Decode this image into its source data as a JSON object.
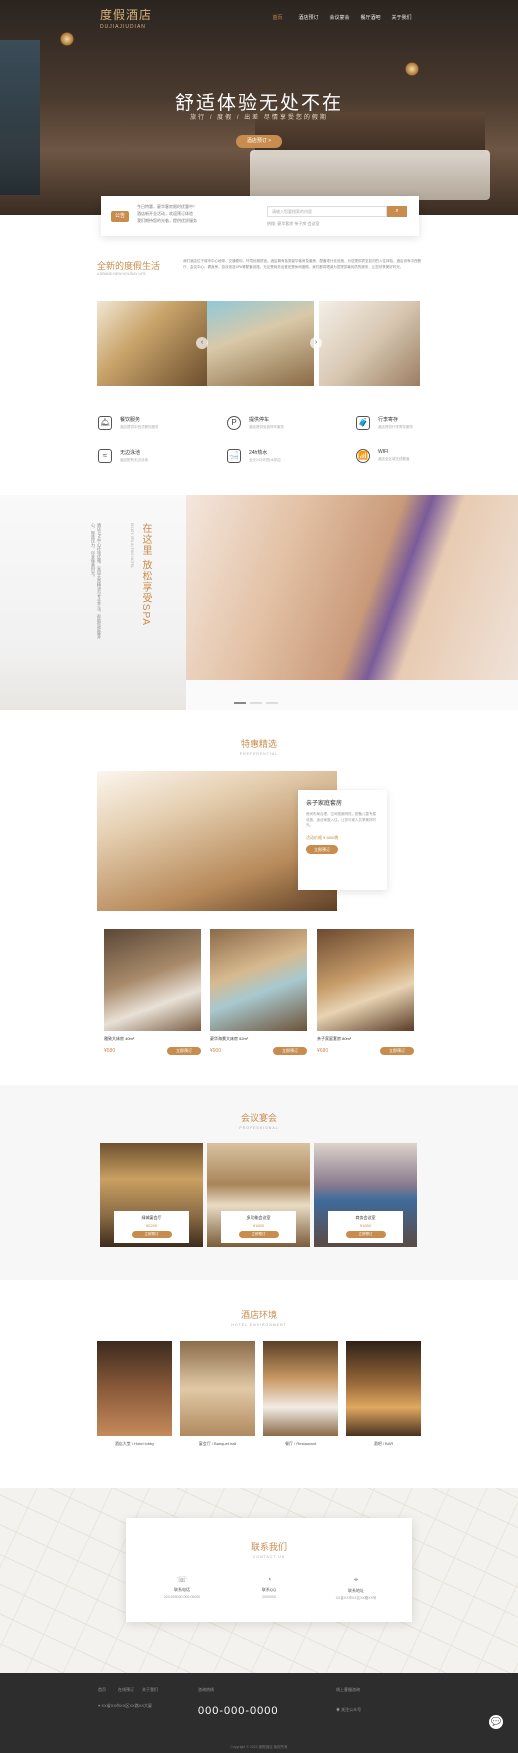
{
  "brand": {
    "name": "度假酒店",
    "en": "DUJIAJIUDIAN"
  },
  "nav": [
    "首页",
    "酒店预订",
    "会议宴会",
    "餐厅酒吧",
    "关于我们"
  ],
  "hero": {
    "title": "舒适体验无处不在",
    "subtitle": "旅行 / 度假 / 出差 尽情享受您的假期",
    "button": "酒店预订 >"
  },
  "notice": {
    "tag": "公告",
    "lines": [
      "今日特惠，豪华客房限时优惠中！",
      "酒店新开业活动，欢迎预订体验",
      "我们期待您的光临，提供优质服务"
    ],
    "search_placeholder": "请输入您要搜索的内容",
    "hot": "热搜: 豪华套房  亲子房  会议室"
  },
  "intro": {
    "title": "全新的度假生活",
    "en": "A BRAND NEW HOLIDAY LIFE",
    "text": "我们酒店位于城市中心地带，交通便利，环境优雅舒适。酒店拥有各类豪华客房及套房，配备现代化设施，为您提供宾至如归的入住体验。酒店设有中西餐厅、会议中心、健身房、游泳池及SPA等配套设施，无论是商务出差还是休闲度假，我们都将竭诚为您提供最优质的服务，让您尽享美好时光。"
  },
  "facilities": [
    {
      "icon": "bell-icon",
      "glyph": "🛎",
      "name": "餐饮服务",
      "desc": "酒店提供中西式餐饮服务"
    },
    {
      "icon": "parking-icon",
      "glyph": "P",
      "name": "提供停车",
      "desc": "酒店提供免费停车服务"
    },
    {
      "icon": "luggage-icon",
      "glyph": "🧳",
      "name": "行李寄存",
      "desc": "酒店提供行李寄存服务"
    },
    {
      "icon": "pool-icon",
      "glyph": "≈",
      "name": "无边泳池",
      "desc": "酒店配有无边泳池"
    },
    {
      "icon": "bathtub-icon",
      "glyph": "🛁",
      "name": "24h热水",
      "desc": "全天24小时热水供应"
    },
    {
      "icon": "wifi-icon",
      "glyph": "📶",
      "name": "WIFI",
      "desc": "酒店全区域无线覆盖"
    }
  ],
  "spa": {
    "title": "在这里 放松享受SPA",
    "en": "ENJOY SPA IN THIS HOTEL",
    "text": "酒店SPA中心环境优雅，采用天然精油与专业手法，帮助您舒缓身心，释放压力，尽享惬意时光。"
  },
  "rooms": {
    "title": "特惠精选",
    "en": "PREFERENTIAL",
    "featured": {
      "name": "亲子家庭套房",
      "desc": "房间布局合理，空间宽敞明亮，配备儿童专属设施，适合家庭入住，让您与家人共享美好时光。",
      "price": "活动价格 ¥ 680/晚",
      "button": "立即预订"
    },
    "list": [
      {
        "name": "雅致大床房 40m²",
        "price": "¥580",
        "button": "立即预订"
      },
      {
        "name": "豪华海景大床房 52m²",
        "price": "¥900",
        "button": "立即预订"
      },
      {
        "name": "亲子家庭套房 80m²",
        "price": "¥680",
        "button": "立即预订"
      }
    ]
  },
  "meeting": {
    "title": "会议宴会",
    "en": "PROFESSIONAL",
    "list": [
      {
        "name": "绿城宴会厅",
        "price": "¥2200",
        "button": "立即预订"
      },
      {
        "name": "多功能会议室",
        "price": "¥1800",
        "button": "立即预订"
      },
      {
        "name": "商务会议室",
        "price": "¥1850",
        "button": "立即预订"
      }
    ]
  },
  "env": {
    "title": "酒店环境",
    "en": "HOTEL ENVIRONMENT",
    "list": [
      "酒店大堂 / Hotel lobby",
      "宴会厅 / Banquet hall",
      "餐厅 / Restaurant",
      "酒吧 / BAR"
    ]
  },
  "contact": {
    "title": "联系我们",
    "en": "CONTACT US",
    "items": [
      {
        "icon": "phone-icon",
        "glyph": "☏",
        "k": "联系电话",
        "v": "020-000000 000-00000"
      },
      {
        "icon": "qq-icon",
        "glyph": "◔",
        "k": "联系QQ",
        "v": "2000000"
      },
      {
        "icon": "location-icon",
        "glyph": "⌖",
        "k": "联系地址",
        "v": "XX省XX市XX区XX路XX号"
      }
    ]
  },
  "footer": {
    "links": [
      "首页",
      "在线预订",
      "关于我们"
    ],
    "address": "XX省XX市XX区XX路XX大厦",
    "consult": "咨询热线",
    "tel": "000-000-0000",
    "online": "线上客服咨询",
    "wechat": "关注公众号",
    "copy": "Copyright © 2023 度假酒店 版权所有"
  },
  "colors": {
    "accent": "#c88d4e",
    "footer": "#2d2d2d"
  }
}
